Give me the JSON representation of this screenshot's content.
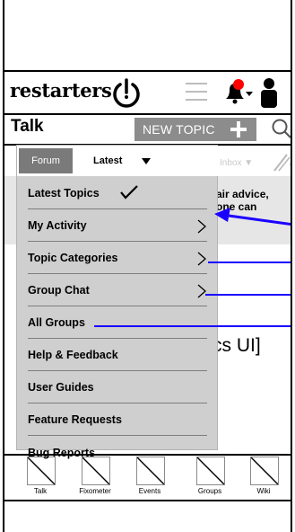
{
  "header": {
    "logo_text": "restarters"
  },
  "talk": {
    "title": "Talk",
    "new_topic_label": "NEW TOPIC"
  },
  "tabs": {
    "forum_label": "Forum",
    "latest_label": "Latest",
    "inbox_label": "Inbox ▼"
  },
  "background_content": {
    "note_line1": "air advice,",
    "note_line2": "one can",
    "ui_label": "cs UI]"
  },
  "menu": {
    "items": [
      {
        "label": "Latest Topics",
        "checked": true,
        "has_submenu": false
      },
      {
        "label": "My Activity",
        "checked": false,
        "has_submenu": true
      },
      {
        "label": "Topic Categories",
        "checked": false,
        "has_submenu": true
      },
      {
        "label": "Group Chat",
        "checked": false,
        "has_submenu": true
      },
      {
        "label": "All Groups",
        "checked": false,
        "has_submenu": false
      },
      {
        "label": "Help & Feedback",
        "checked": false,
        "has_submenu": false
      },
      {
        "label": "User Guides",
        "checked": false,
        "has_submenu": false
      },
      {
        "label": "Feature Requests",
        "checked": false,
        "has_submenu": false
      },
      {
        "label": "Bug Reports",
        "checked": false,
        "has_submenu": false
      }
    ]
  },
  "bottom_nav": [
    {
      "label": "Talk",
      "icon": "placeholder-icon"
    },
    {
      "label": "Fixometer",
      "icon": "placeholder-icon"
    },
    {
      "label": "Events",
      "icon": "placeholder-icon"
    },
    {
      "label": "Groups",
      "icon": "placeholder-icon"
    },
    {
      "label": "Wiki",
      "icon": "placeholder-icon"
    }
  ],
  "colors": {
    "notification": "#ff0000",
    "annotation": "#1a00ff",
    "menu_bg": "#cfcfcf",
    "forum_tab": "#7a7a7a",
    "new_topic_bg": "#8c8c8c"
  }
}
